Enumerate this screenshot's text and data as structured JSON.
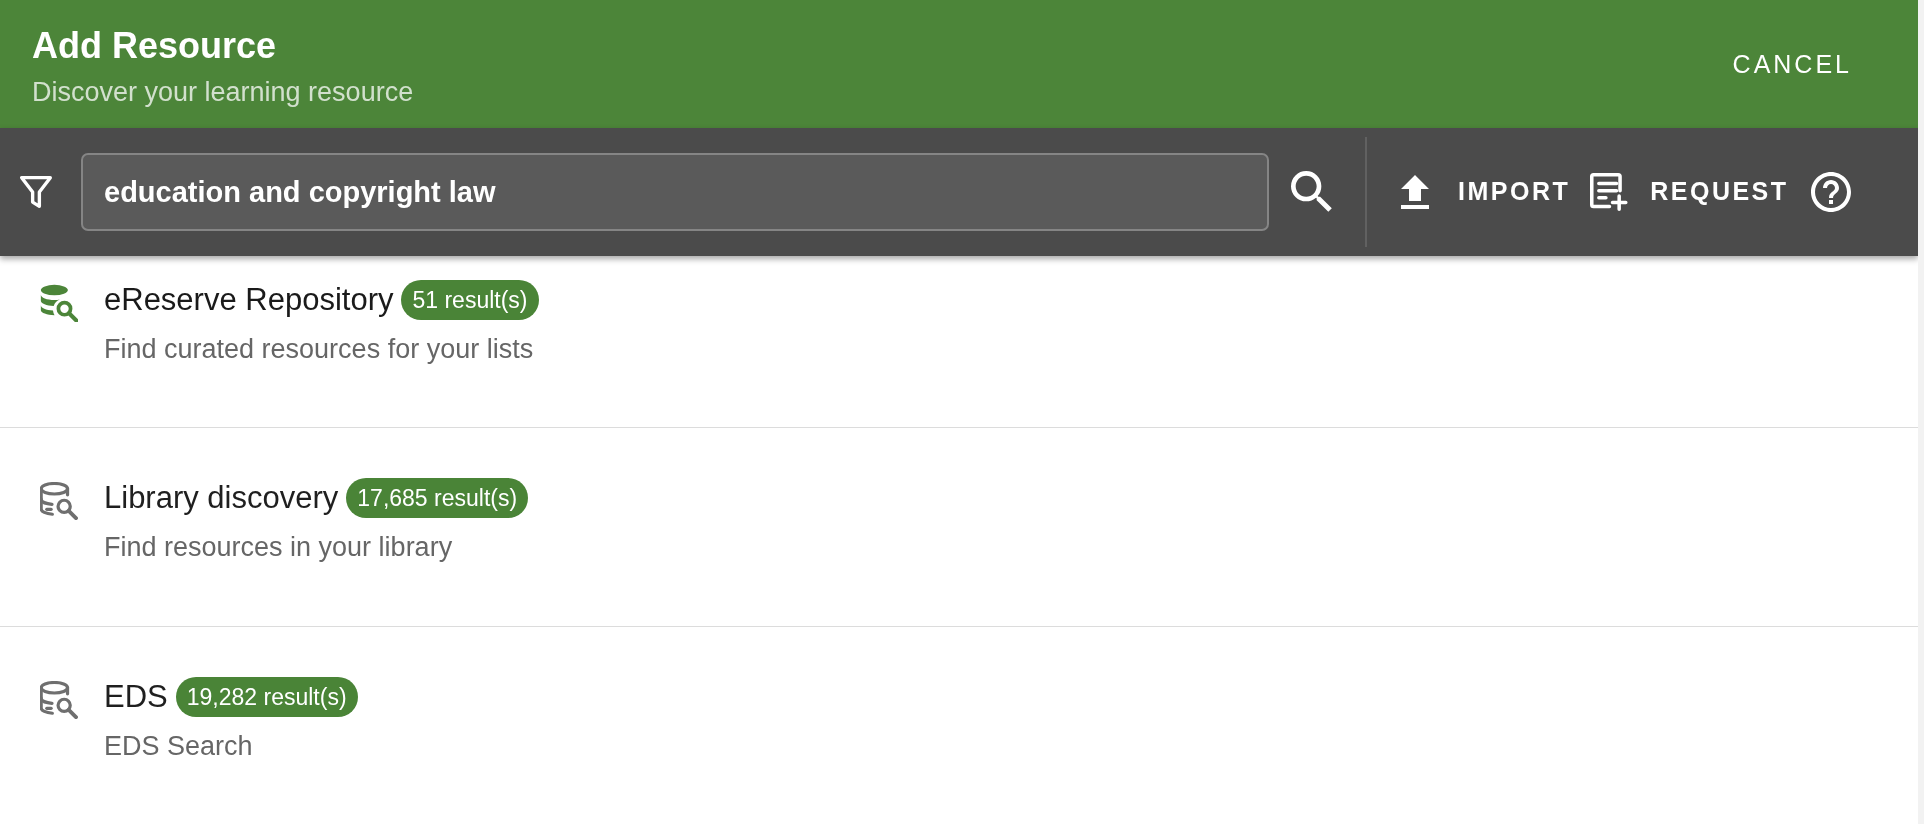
{
  "header": {
    "title": "Add Resource",
    "subtitle": "Discover your learning resource",
    "cancel_button": "CANCEL"
  },
  "toolbar": {
    "search": {
      "value": "education and copyright law"
    },
    "import_button": "IMPORT",
    "request_button": "REQUEST"
  },
  "sources": [
    {
      "name": "eReserve Repository",
      "count": "51 result(s)",
      "description": "Find curated resources for your lists",
      "selected": true
    },
    {
      "name": "Library discovery",
      "count": "17,685 result(s)",
      "description": "Find resources in your library",
      "selected": false
    },
    {
      "name": "EDS",
      "count": "19,282 result(s)",
      "description": "EDS Search",
      "selected": false
    }
  ]
}
